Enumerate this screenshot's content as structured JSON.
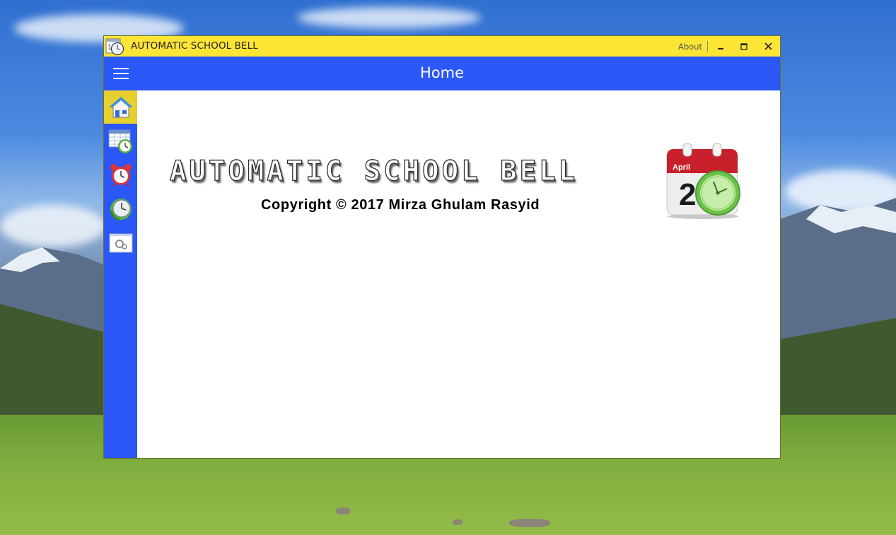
{
  "window": {
    "title": "AUTOMATIC SCHOOL BELL",
    "about_label": "About",
    "controls": [
      "minimize-icon",
      "maximize-icon",
      "close-icon"
    ]
  },
  "header": {
    "menu_icon": "hamburger-icon",
    "title": "Home"
  },
  "sidebar": {
    "items": [
      {
        "icon": "home-icon",
        "active": true
      },
      {
        "icon": "schedule-table-clock-icon",
        "active": false
      },
      {
        "icon": "alarm-clock-icon",
        "active": false
      },
      {
        "icon": "clock-refresh-icon",
        "active": false
      },
      {
        "icon": "settings-window-icon",
        "active": false
      }
    ]
  },
  "main": {
    "app_name_banner": "AUTOMATIC SCHOOL BELL",
    "copyright": "Copyright © 2017 Mirza Ghulam Rasyid",
    "logo": {
      "month": "April",
      "day": "2",
      "icon": "calendar-clock-icon"
    }
  },
  "colors": {
    "titlebar": "#fde536",
    "accent_blue": "#2b57f7",
    "active_nav": "#e6cf2e",
    "content_bg": "#ffffff",
    "calendar_red": "#c8202a",
    "clock_green": "#6cc24a"
  }
}
